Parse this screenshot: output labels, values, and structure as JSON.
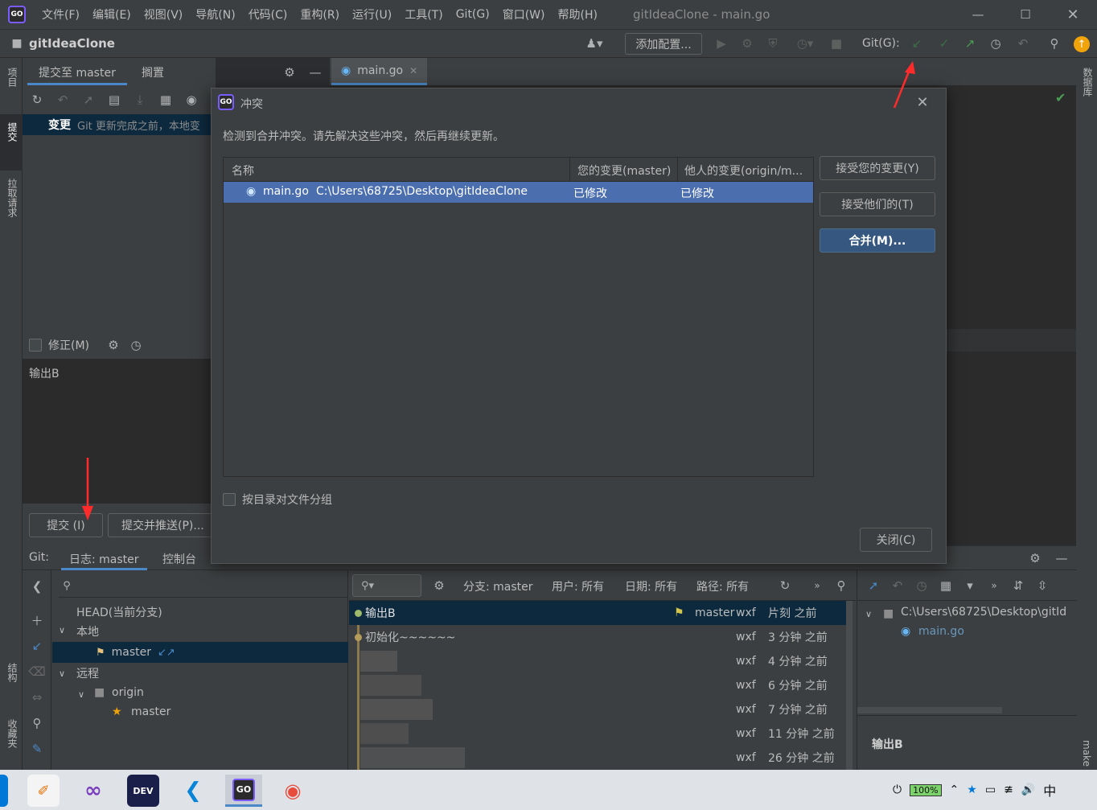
{
  "window": {
    "title": "gitIdeaClone - main.go",
    "menu": [
      "文件(F)",
      "编辑(E)",
      "视图(V)",
      "导航(N)",
      "代码(C)",
      "重构(R)",
      "运行(U)",
      "工具(T)",
      "Git(G)",
      "窗口(W)",
      "帮助(H)"
    ]
  },
  "navbar": {
    "project": "gitIdeaClone",
    "add_config": "添加配置...",
    "git_label": "Git(G):"
  },
  "left_strip": {
    "project": "项目",
    "commit": "提交",
    "pull_requests": "拉取请求",
    "structure": "结构",
    "favorites": "收藏夹"
  },
  "right_strip": {
    "database": "数据库",
    "make": "make"
  },
  "commit_panel": {
    "tab_commit": "提交至 master",
    "tab_shelf": "搁置",
    "changes_label": "变更",
    "changes_note": "Git 更新完成之前，本地变",
    "amend": "修正(M)",
    "message": "输出B",
    "commit_btn": "提交 (I)",
    "commit_push_btn": "提交并推送(P)..."
  },
  "editor": {
    "tab": "main.go"
  },
  "dialog": {
    "title": "冲突",
    "message": "检测到合并冲突。请先解决这些冲突，然后再继续更新。",
    "col_name": "名称",
    "col_yours": "您的变更(master)",
    "col_theirs": "他人的变更(origin/m...",
    "file": {
      "name": "main.go",
      "path": "C:\\Users\\68725\\Desktop\\gitIdeaClone",
      "yours": "已修改",
      "theirs": "已修改"
    },
    "accept_yours": "接受您的变更(Y)",
    "accept_theirs": "接受他们的(T)",
    "merge": "合并(M)...",
    "group_by_dir": "按目录对文件分组",
    "close": "关闭(C)"
  },
  "git_panel": {
    "label": "Git:",
    "tab_log": "日志: master",
    "tab_console": "控制台",
    "head": "HEAD(当前分支)",
    "local": "本地",
    "local_master": "master",
    "remote": "远程",
    "origin": "origin",
    "remote_master": "master",
    "filter_branch": "分支: master",
    "filter_user": "用户: 所有",
    "filter_date": "日期: 所有",
    "filter_path": "路径: 所有",
    "commits": [
      {
        "msg": "输出B",
        "tag": "master",
        "author": "wxf",
        "time": "片刻 之前"
      },
      {
        "msg": "初始化~~~~~~",
        "tag": "",
        "author": "wxf",
        "time": "3 分钟 之前"
      },
      {
        "msg": "",
        "tag": "",
        "author": "wxf",
        "time": "4 分钟 之前"
      },
      {
        "msg": "",
        "tag": "",
        "author": "wxf",
        "time": "6 分钟 之前"
      },
      {
        "msg": "",
        "tag": "",
        "author": "wxf",
        "time": "7 分钟 之前"
      },
      {
        "msg": "",
        "tag": "",
        "author": "wxf",
        "time": "11 分钟 之前"
      },
      {
        "msg": "",
        "tag": "",
        "author": "wxf",
        "time": "26 分钟 之前"
      }
    ],
    "detail_path": "C:\\Users\\68725\\Desktop\\gitId",
    "detail_file": "main.go",
    "detail_msg": "输出B"
  },
  "taskbar": {
    "battery": "100%",
    "ime": "中"
  },
  "colors": {
    "accent": "#4b6eaf",
    "selection": "#2f65ca",
    "arrow": "#ff2b2b",
    "git_green": "#499c54",
    "ide_bg": "#3c3f41"
  }
}
